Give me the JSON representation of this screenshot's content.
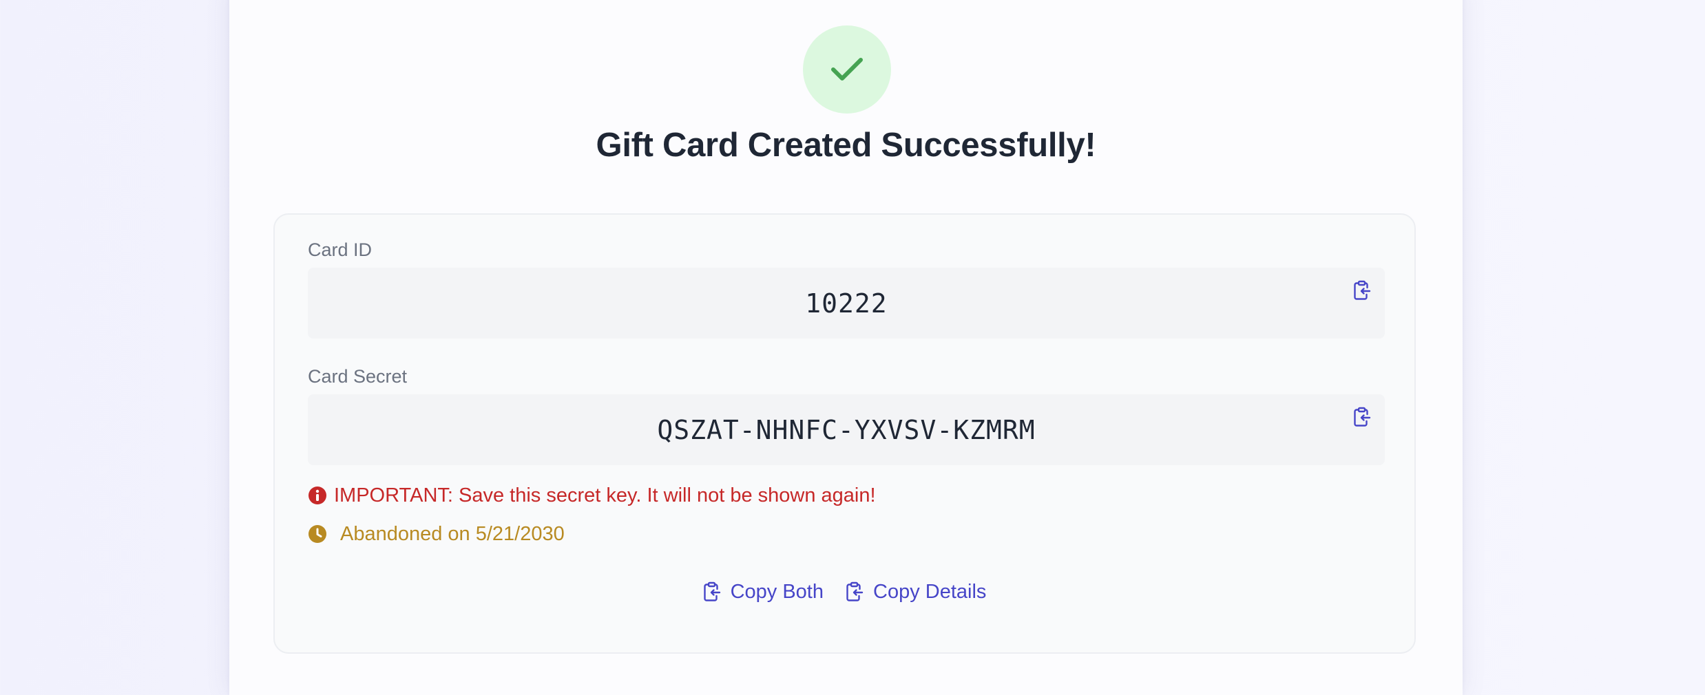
{
  "page": {
    "title": "Gift Card Created Successfully!",
    "success_icon": "check-icon"
  },
  "card_id": {
    "label": "Card ID",
    "value": "10222",
    "copy_icon": "clipboard-copy-icon"
  },
  "card_secret": {
    "label": "Card Secret",
    "value": "QSZAT-NHNFC-YXVSV-KZMRM",
    "copy_icon": "clipboard-copy-icon"
  },
  "notices": {
    "warning_text": "IMPORTANT: Save this secret key. It will not be shown again!",
    "warning_icon": "info-circle-icon",
    "expiry_text": "Abandoned on 5/21/2030",
    "expiry_icon": "clock-icon"
  },
  "actions": {
    "copy_both_label": "Copy Both",
    "copy_details_label": "Copy Details"
  },
  "colors": {
    "success_bg": "#dcf8df",
    "success_check": "#45a352",
    "accent": "#4645c8",
    "warning": "#c62828",
    "expiry": "#b88a22",
    "title": "#1f2735"
  }
}
